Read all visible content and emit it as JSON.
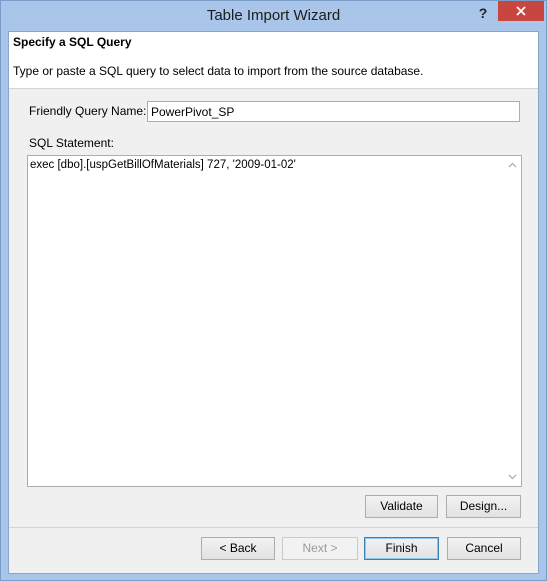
{
  "window": {
    "title": "Table Import Wizard",
    "help_label": "?"
  },
  "header": {
    "title": "Specify a SQL Query",
    "subtitle": "Type or paste a SQL query to select data to import from the source database."
  },
  "form": {
    "friendly_label": "Friendly Query Name:",
    "friendly_value": "PowerPivot_SP",
    "sql_label": "SQL Statement:",
    "sql_value": "exec [dbo].[uspGetBillOfMaterials] 727, '2009-01-02'"
  },
  "buttons": {
    "validate": "Validate",
    "design": "Design...",
    "back": "< Back",
    "next": "Next >",
    "finish": "Finish",
    "cancel": "Cancel"
  },
  "colors": {
    "titlebar": "#a9c5ea",
    "close_button": "#c7463f",
    "dialog_bg": "#f0f0f0"
  },
  "icons": {
    "close": "close-icon",
    "scroll_up": "chevron-up-icon",
    "scroll_down": "chevron-down-icon"
  }
}
